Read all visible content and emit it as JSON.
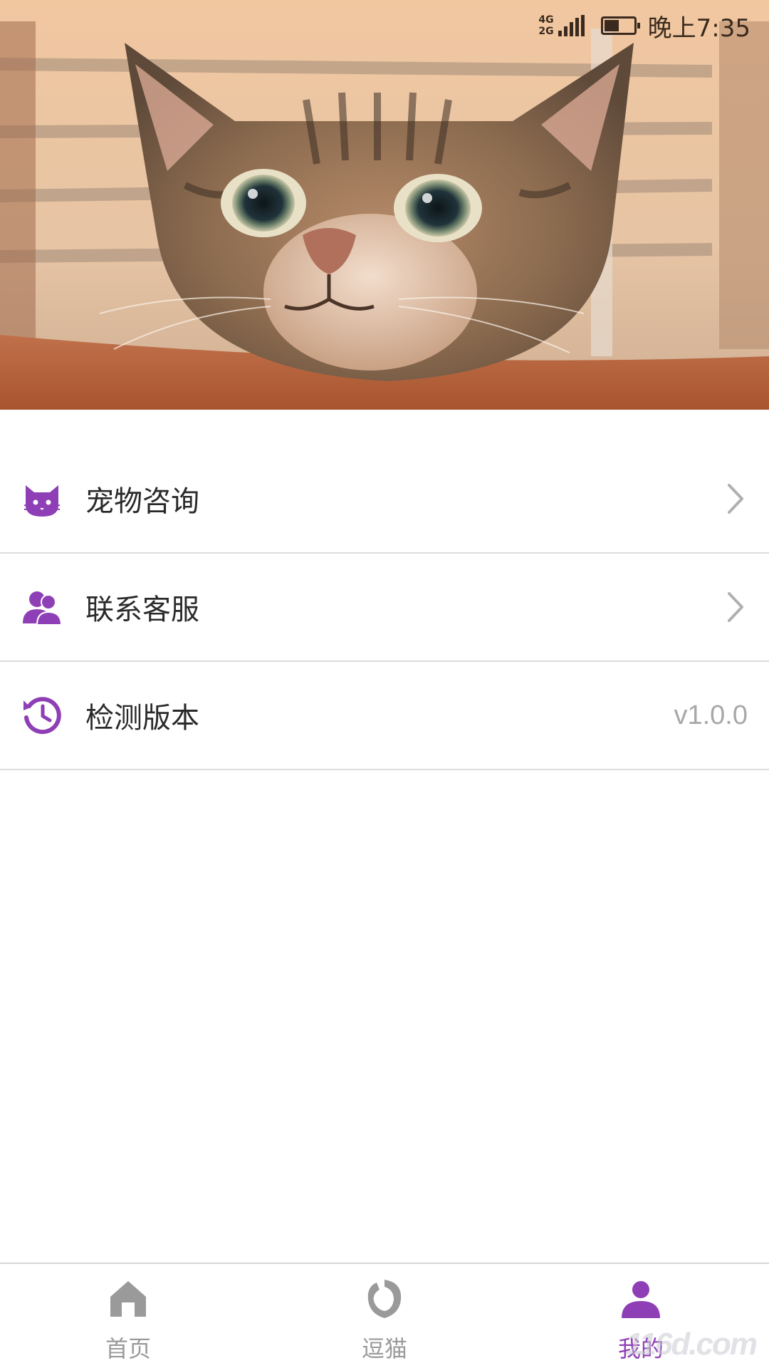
{
  "status_bar": {
    "network_top": "4G",
    "network_bottom": "2G",
    "time": "晚上7:35"
  },
  "hero": {
    "image": "tabby-cat-photo"
  },
  "menu": {
    "items": [
      {
        "label": "宠物咨询",
        "icon": "cat-icon",
        "trailing": "chevron"
      },
      {
        "label": "联系客服",
        "icon": "users-icon",
        "trailing": "chevron"
      },
      {
        "label": "检测版本",
        "icon": "history-icon",
        "value": "v1.0.0"
      }
    ]
  },
  "bottom_nav": {
    "items": [
      {
        "label": "首页",
        "icon": "home-icon",
        "active": false
      },
      {
        "label": "逗猫",
        "icon": "cat-play-icon",
        "active": false
      },
      {
        "label": "我的",
        "icon": "person-icon",
        "active": true
      }
    ]
  },
  "colors": {
    "accent": "#8e3fb5",
    "inactive": "#9a9a9a",
    "divider": "#dcdcdc"
  },
  "watermark": "116d.com"
}
